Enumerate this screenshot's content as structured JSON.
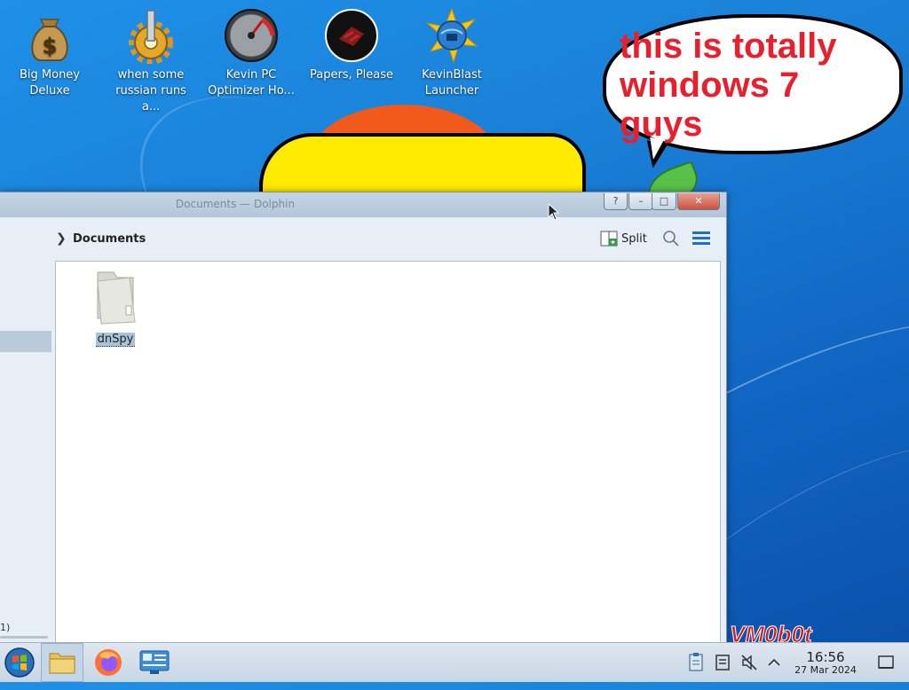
{
  "desktop": {
    "icons": [
      {
        "label": "Big Money\nDeluxe",
        "icon": "money-bag-icon"
      },
      {
        "label": "when some\nrussian runs a...",
        "icon": "gear-icon"
      },
      {
        "label": "Kevin PC\nOptimizer Ho...",
        "icon": "speedometer-icon"
      },
      {
        "label": "Papers, Please",
        "icon": "papers-please-icon"
      },
      {
        "label": "KevinBlast\nLauncher",
        "icon": "globe-star-icon"
      }
    ],
    "meme_text": "this is totally windows 7 guys",
    "watermark": "VM0b0t"
  },
  "window": {
    "title": "Documents — Dolphin",
    "breadcrumb": "Documents",
    "split_label": "Split",
    "sidebar_status": "1)",
    "files": [
      {
        "name": "dnSpy",
        "type": "folder",
        "selected": true
      }
    ]
  },
  "taskbar": {
    "items": [
      "start-orb-icon",
      "file-manager-icon",
      "firefox-icon",
      "system-settings-icon"
    ],
    "clock": {
      "time": "16:56",
      "date": "27 Mar 2024"
    }
  },
  "colors": {
    "desktop_bg": "#1a7fd6",
    "meme_text": "#e8202e",
    "selection": "#a9c4d8"
  }
}
